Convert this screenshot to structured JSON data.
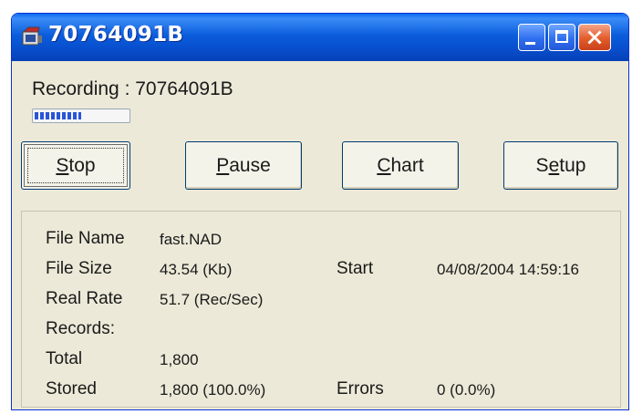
{
  "window": {
    "title": "70764091B"
  },
  "status": {
    "recording_label": "Recording",
    "separator": " : ",
    "recording_id": "70764091B",
    "progress_fraction": 0.5
  },
  "buttons": {
    "stop": {
      "accel": "S",
      "rest": "top"
    },
    "pause": {
      "accel": "P",
      "rest": "ause"
    },
    "chart": {
      "accel": "C",
      "rest": "hart"
    },
    "setup": {
      "pre": "S",
      "accel": "e",
      "rest": "tup"
    }
  },
  "info": {
    "file_name_label": "File Name",
    "file_name_value": "fast.NAD",
    "file_size_label": "File Size",
    "file_size_value": "43.54 (Kb)",
    "start_label": "Start",
    "start_value": "04/08/2004 14:59:16",
    "real_rate_label": "Real Rate",
    "real_rate_value": "51.7 (Rec/Sec)",
    "records_label": "Records:",
    "total_label": "Total",
    "total_value": "1,800",
    "stored_label": "Stored",
    "stored_value": "1,800 (100.0%)",
    "errors_label": "Errors",
    "errors_value": "0 (0.0%)"
  }
}
